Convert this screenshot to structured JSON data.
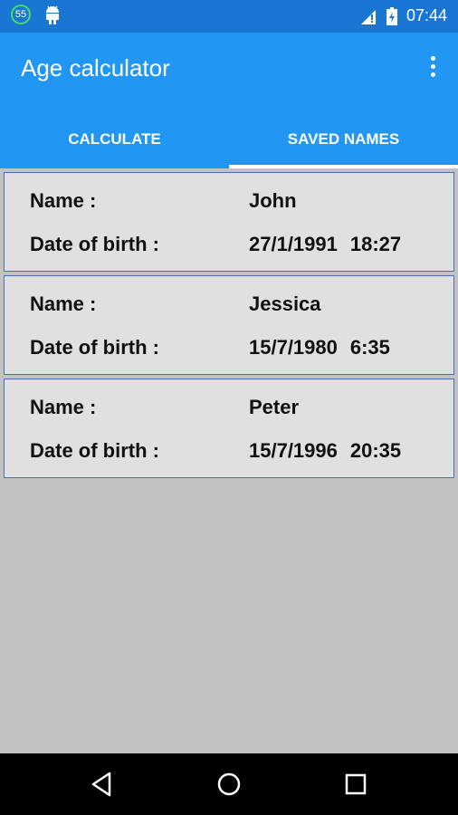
{
  "status_bar": {
    "notification_badge": "55",
    "time": "07:44"
  },
  "app_bar": {
    "title": "Age calculator"
  },
  "tabs": [
    {
      "label": "CALCULATE",
      "active": false
    },
    {
      "label": "SAVED NAMES",
      "active": true
    }
  ],
  "saved_names": [
    {
      "name_label": "Name :",
      "name": "John",
      "dob_label": "Date of birth :",
      "date": "27/1/1991",
      "time": "18:27"
    },
    {
      "name_label": "Name :",
      "name": "Jessica",
      "dob_label": "Date of birth :",
      "date": "15/7/1980",
      "time": "6:35"
    },
    {
      "name_label": "Name :",
      "name": "Peter",
      "dob_label": "Date of birth :",
      "date": "15/7/1996",
      "time": "20:35"
    }
  ],
  "colors": {
    "status_bar": "#1976d2",
    "app_bar": "#2196f3",
    "card_background": "#e0e0e0",
    "card_border": "#4a6fb5",
    "page_background": "#c2c2c2"
  },
  "icons": [
    "badge-icon",
    "android-icon",
    "signal-icon",
    "battery-icon",
    "overflow-menu-icon",
    "back-icon",
    "home-icon",
    "recents-icon"
  ]
}
